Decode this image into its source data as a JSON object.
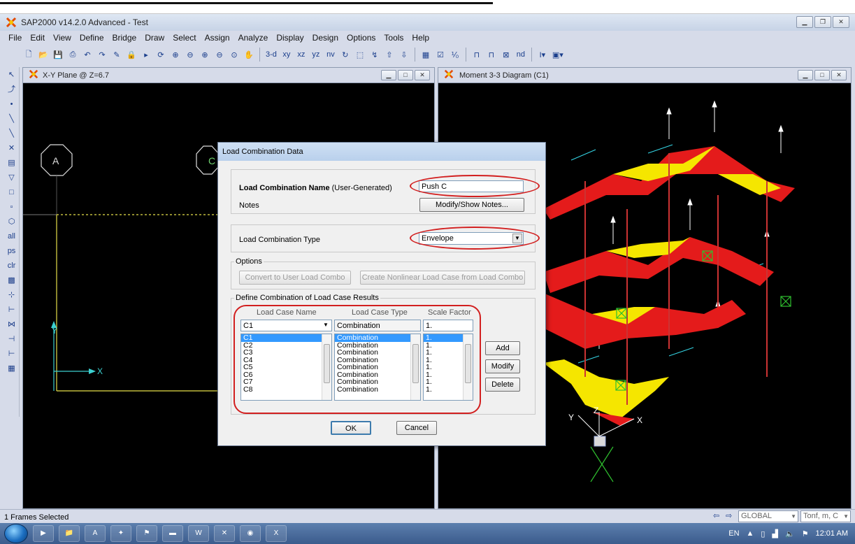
{
  "app": {
    "title": "SAP2000 v14.2.0 Advanced  - Test"
  },
  "menu": [
    "File",
    "Edit",
    "View",
    "Define",
    "Bridge",
    "Draw",
    "Select",
    "Assign",
    "Analyze",
    "Display",
    "Design",
    "Options",
    "Tools",
    "Help"
  ],
  "toolbar": {
    "view_3d": "3-d",
    "view_xy": "xy",
    "view_xz": "xz",
    "view_yz": "yz",
    "view_nv": "nv",
    "fraction": "⅟₀",
    "nd": "nd"
  },
  "left_viewport": {
    "title": "X-Y Plane @ Z=6.7",
    "grid_a": "A",
    "grid_c": "C",
    "axis_y": "Y",
    "axis_x": "X"
  },
  "right_viewport": {
    "title": "Moment 3-3 Diagram  (C1)",
    "axis_x": "X",
    "axis_y": "Y",
    "axis_z": "Z"
  },
  "dialog": {
    "title": "Load Combination Data",
    "name_label": "Load Combination Name",
    "name_label_suffix": "(User-Generated)",
    "name_value": "Push C",
    "notes_label": "Notes",
    "notes_button": "Modify/Show Notes...",
    "type_label": "Load Combination Type",
    "type_value": "Envelope",
    "options_label": "Options",
    "convert_button": "Convert to User Load Combo",
    "create_button": "Create Nonlinear Load Case from Load Combo",
    "define_label": "Define Combination of Load Case Results",
    "col_name": "Load Case Name",
    "col_type": "Load Case Type",
    "col_factor": "Scale Factor",
    "current_case": "C1",
    "current_type": "Combination",
    "current_factor": "1.",
    "rows": [
      {
        "name": "C1",
        "type": "Combination",
        "factor": "1."
      },
      {
        "name": "C2",
        "type": "Combination",
        "factor": "1."
      },
      {
        "name": "C3",
        "type": "Combination",
        "factor": "1."
      },
      {
        "name": "C4",
        "type": "Combination",
        "factor": "1."
      },
      {
        "name": "C5",
        "type": "Combination",
        "factor": "1."
      },
      {
        "name": "C6",
        "type": "Combination",
        "factor": "1."
      },
      {
        "name": "C7",
        "type": "Combination",
        "factor": "1."
      },
      {
        "name": "C8",
        "type": "Combination",
        "factor": "1."
      }
    ],
    "add_button": "Add",
    "modify_button": "Modify",
    "delete_button": "Delete",
    "ok_button": "OK",
    "cancel_button": "Cancel"
  },
  "status": {
    "left": "1 Frames Selected",
    "coord_system": "GLOBAL",
    "units": "Tonf, m, C"
  },
  "taskbar": {
    "lang": "EN",
    "time": "12:01 AM"
  }
}
